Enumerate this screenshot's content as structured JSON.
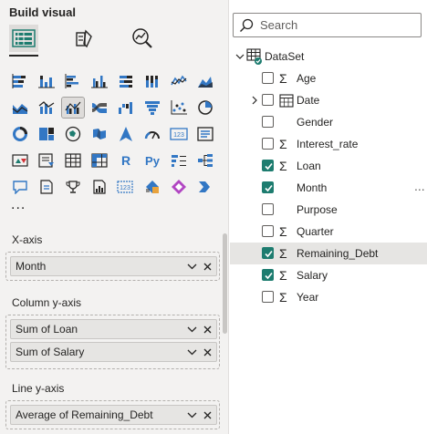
{
  "left": {
    "title": "Build visual",
    "more_label": "...",
    "tabs": [
      {
        "name": "build-visual-tab-icon",
        "selected": true
      },
      {
        "name": "format-visual-tab-icon",
        "selected": false
      },
      {
        "name": "analytics-tab-icon",
        "selected": false
      }
    ],
    "wells": [
      {
        "label": "X-axis",
        "fields": [
          "Month"
        ]
      },
      {
        "label": "Column y-axis",
        "fields": [
          "Sum of Loan",
          "Sum of Salary"
        ]
      },
      {
        "label": "Line y-axis",
        "fields": [
          "Average of Remaining_Debt"
        ]
      }
    ]
  },
  "right": {
    "search_placeholder": "Search",
    "dataset_name": "DataSet",
    "fields": [
      {
        "name": "Age",
        "sigma": true,
        "checked": false
      },
      {
        "name": "Date",
        "sigma": false,
        "calendar": true,
        "expand": true,
        "checked": false
      },
      {
        "name": "Gender",
        "sigma": false,
        "checked": false
      },
      {
        "name": "Interest_rate",
        "sigma": true,
        "checked": false
      },
      {
        "name": "Loan",
        "sigma": true,
        "checked": true
      },
      {
        "name": "Month",
        "sigma": false,
        "checked": true,
        "more": "..."
      },
      {
        "name": "Purpose",
        "sigma": false,
        "checked": false
      },
      {
        "name": "Quarter",
        "sigma": true,
        "checked": false
      },
      {
        "name": "Remaining_Debt",
        "sigma": true,
        "checked": true,
        "highlight": true
      },
      {
        "name": "Salary",
        "sigma": true,
        "checked": true
      },
      {
        "name": "Year",
        "sigma": true,
        "checked": false
      }
    ]
  },
  "colors": {
    "accent": "#1d7c6f",
    "blue": "#3277c4",
    "panel": "#f3f2f1"
  }
}
